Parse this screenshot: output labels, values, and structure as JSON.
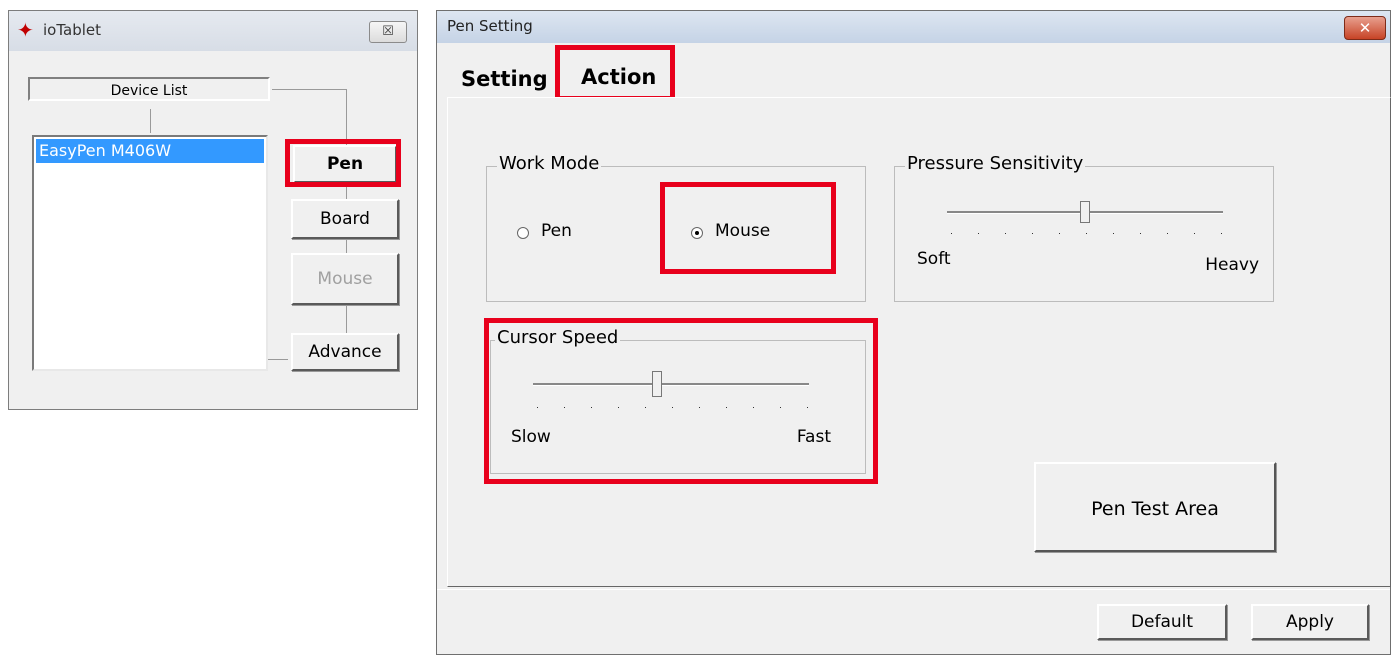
{
  "iotablet": {
    "title": "ioTablet",
    "close_glyph": "☒",
    "device_list_label": "Device List",
    "devices": [
      "EasyPen M406W"
    ],
    "buttons": {
      "pen": "Pen",
      "board": "Board",
      "mouse": "Mouse",
      "advance": "Advance"
    }
  },
  "pen_setting": {
    "title": "Pen Setting",
    "close_glyph": "✕",
    "tabs": [
      "Setting",
      "Action"
    ],
    "selected_tab": "Action",
    "work_mode": {
      "label": "Work Mode",
      "options": [
        "Pen",
        "Mouse"
      ],
      "selected": "Mouse"
    },
    "pressure_sensitivity": {
      "label": "Pressure Sensitivity",
      "min_label": "Soft",
      "max_label": "Heavy",
      "value_fraction": 0.5
    },
    "cursor_speed": {
      "label": "Cursor Speed",
      "min_label": "Slow",
      "max_label": "Fast",
      "value_fraction": 0.45
    },
    "pen_test_area": "Pen Test Area",
    "buttons": {
      "default": "Default",
      "apply": "Apply"
    }
  },
  "highlight_color": "#e8001c",
  "selection_color": "#3399ff"
}
